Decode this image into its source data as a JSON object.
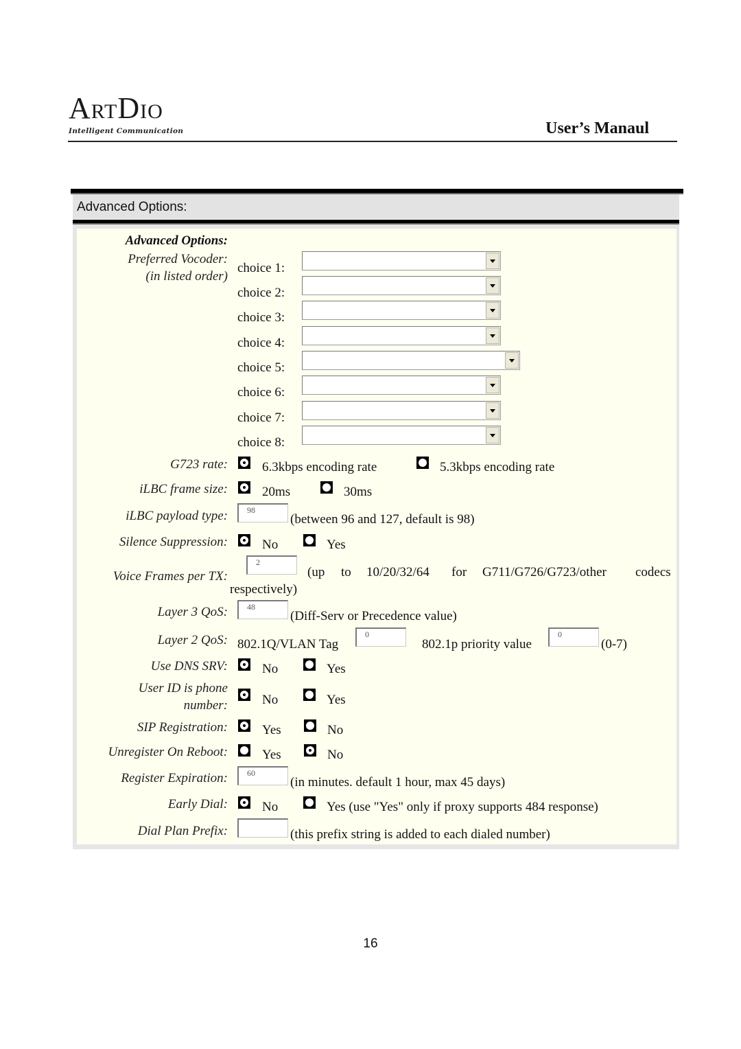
{
  "header": {
    "logo_main_1": "A",
    "logo_main_2": "RT",
    "logo_main_3": "D",
    "logo_main_4": "IO",
    "logo_tagline": "Intelligent Communication",
    "doc_title": "User’s Manaul"
  },
  "section": {
    "header_title": "Advanced Options:",
    "panel_title": "Advanced Options:"
  },
  "vocoder": {
    "label_line1": "Preferred Vocoder:",
    "label_line2": "(in listed order)",
    "choices": [
      {
        "label": "choice 1:",
        "value": ""
      },
      {
        "label": "choice 2:",
        "value": ""
      },
      {
        "label": "choice 3:",
        "value": ""
      },
      {
        "label": "choice 4:",
        "value": ""
      },
      {
        "label": "choice 5:",
        "value": ""
      },
      {
        "label": "choice 6:",
        "value": ""
      },
      {
        "label": "choice 7:",
        "value": ""
      },
      {
        "label": "choice 8:",
        "value": ""
      }
    ]
  },
  "g723_rate": {
    "label": "G723 rate:",
    "options": [
      {
        "label": "6.3kbps encoding rate",
        "selected": true
      },
      {
        "label": "5.3kbps encoding rate",
        "selected": false
      }
    ]
  },
  "ilbc_frame_size": {
    "label": "iLBC frame size:",
    "options": [
      {
        "label": "20ms",
        "selected": true
      },
      {
        "label": "30ms",
        "selected": false
      }
    ]
  },
  "ilbc_payload_type": {
    "label": "iLBC payload type:",
    "value": "98",
    "hint": "(between 96 and 127, default is 98)"
  },
  "silence_suppression": {
    "label": "Silence Suppression:",
    "options": [
      {
        "label": "No",
        "selected": true
      },
      {
        "label": "Yes",
        "selected": false
      }
    ]
  },
  "voice_frames": {
    "label": "Voice Frames per TX:",
    "value": "2",
    "hint_words": [
      "(up",
      "to",
      "10/20/32/64",
      "for",
      "G711/G726/G723/other",
      "codecs"
    ],
    "hint_line2": "respectively)"
  },
  "layer3_qos": {
    "label": "Layer 3 QoS:",
    "value": "48",
    "hint": "(Diff-Serv or Precedence value)"
  },
  "layer2_qos": {
    "label": "Layer 2 QoS:",
    "vlan_label": "802.1Q/VLAN Tag",
    "vlan_value": "0",
    "priority_label": "802.1p priority value",
    "priority_value": "0",
    "priority_hint": "(0-7)"
  },
  "use_dns_srv": {
    "label": "Use DNS SRV:",
    "options": [
      {
        "label": "No",
        "selected": true
      },
      {
        "label": "Yes",
        "selected": false
      }
    ]
  },
  "user_id_phone": {
    "label_line1": "User ID is phone",
    "label_line2": "number:",
    "options": [
      {
        "label": "No",
        "selected": true
      },
      {
        "label": "Yes",
        "selected": false
      }
    ]
  },
  "sip_registration": {
    "label": "SIP Registration:",
    "options": [
      {
        "label": "Yes",
        "selected": true
      },
      {
        "label": "No",
        "selected": false
      }
    ]
  },
  "unregister_on_reboot": {
    "label": "Unregister On Reboot:",
    "options": [
      {
        "label": "Yes",
        "selected": false
      },
      {
        "label": "No",
        "selected": true
      }
    ]
  },
  "register_expiration": {
    "label": "Register Expiration:",
    "value": "60",
    "hint": "(in minutes. default 1 hour, max 45 days)"
  },
  "early_dial": {
    "label": "Early Dial:",
    "options": [
      {
        "label": "No",
        "selected": true
      },
      {
        "label": "Yes (use \"Yes\" only if proxy supports 484 response)",
        "selected": false
      }
    ]
  },
  "dial_plan_prefix": {
    "label": "Dial Plan Prefix:",
    "value": "",
    "hint": "(this prefix string is added to each dialed number)"
  },
  "footer": {
    "page_number": "16"
  }
}
